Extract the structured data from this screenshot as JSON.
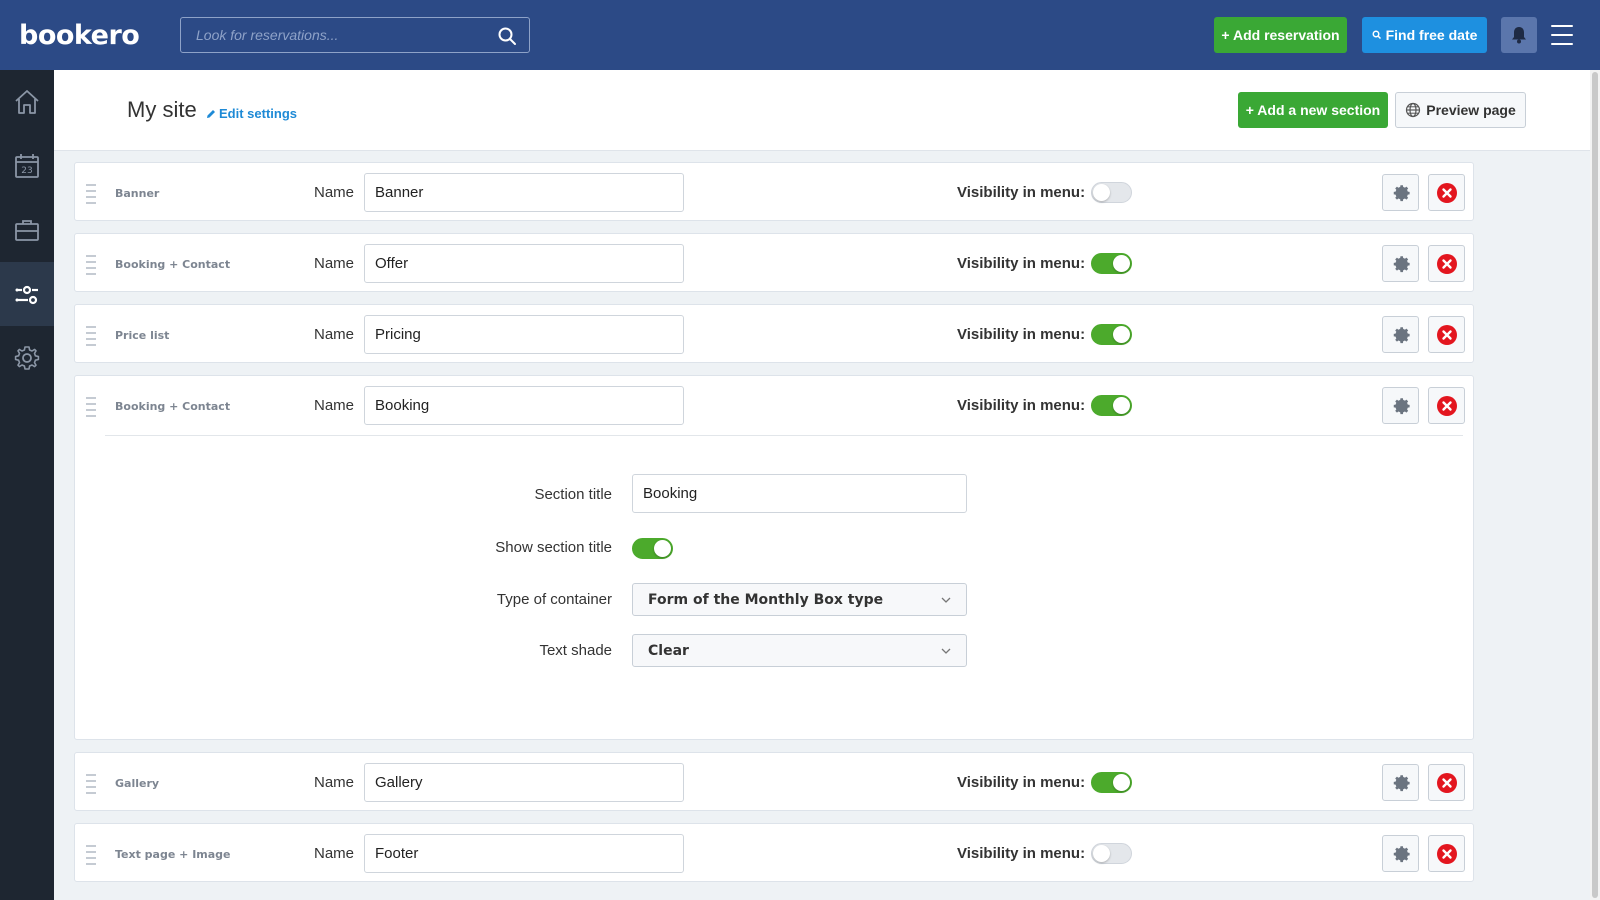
{
  "app": {
    "logo_text": "bookero",
    "search_placeholder": "Look for reservations...",
    "add_reservation_label": "+ Add reservation",
    "find_free_date_label": "Find free date"
  },
  "page": {
    "title": "My site",
    "edit_settings_label": "Edit settings",
    "add_section_label": "+ Add a new section",
    "preview_label": "Preview page"
  },
  "labels": {
    "name": "Name",
    "visibility": "Visibility in menu:"
  },
  "sections": [
    {
      "type": "Banner",
      "name": "Banner",
      "visible": false
    },
    {
      "type": "Booking + Contact",
      "name": "Offer",
      "visible": true
    },
    {
      "type": "Price list",
      "name": "Pricing",
      "visible": true
    },
    {
      "type": "Booking + Contact",
      "name": "Booking",
      "visible": true,
      "expanded": true
    },
    {
      "type": "Gallery",
      "name": "Gallery",
      "visible": true
    },
    {
      "type": "Text page + Image",
      "name": "Footer",
      "visible": false
    }
  ],
  "expanded_settings": {
    "section_title_label": "Section title",
    "section_title_value": "Booking",
    "show_title_label": "Show section title",
    "show_title_on": true,
    "container_label": "Type of container",
    "container_value": "Form of the Monthly Box type",
    "shade_label": "Text shade",
    "shade_value": "Clear"
  },
  "colors": {
    "topbar": "#2c4a86",
    "sidebar": "#1e2631",
    "green": "#3aa835",
    "blue": "#1e90e0",
    "toggle_on": "#4caa2c",
    "delete_red": "#e3161f"
  }
}
